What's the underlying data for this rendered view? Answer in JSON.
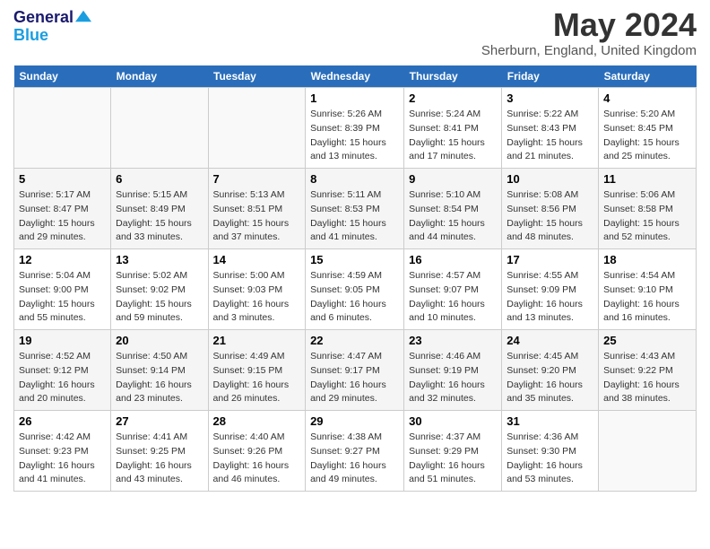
{
  "header": {
    "logo_line1": "General",
    "logo_line2": "Blue",
    "month_year": "May 2024",
    "location": "Sherburn, England, United Kingdom"
  },
  "weekdays": [
    "Sunday",
    "Monday",
    "Tuesday",
    "Wednesday",
    "Thursday",
    "Friday",
    "Saturday"
  ],
  "weeks": [
    [
      {
        "day": "",
        "sunrise": "",
        "sunset": "",
        "daylight": ""
      },
      {
        "day": "",
        "sunrise": "",
        "sunset": "",
        "daylight": ""
      },
      {
        "day": "",
        "sunrise": "",
        "sunset": "",
        "daylight": ""
      },
      {
        "day": "1",
        "sunrise": "Sunrise: 5:26 AM",
        "sunset": "Sunset: 8:39 PM",
        "daylight": "Daylight: 15 hours and 13 minutes."
      },
      {
        "day": "2",
        "sunrise": "Sunrise: 5:24 AM",
        "sunset": "Sunset: 8:41 PM",
        "daylight": "Daylight: 15 hours and 17 minutes."
      },
      {
        "day": "3",
        "sunrise": "Sunrise: 5:22 AM",
        "sunset": "Sunset: 8:43 PM",
        "daylight": "Daylight: 15 hours and 21 minutes."
      },
      {
        "day": "4",
        "sunrise": "Sunrise: 5:20 AM",
        "sunset": "Sunset: 8:45 PM",
        "daylight": "Daylight: 15 hours and 25 minutes."
      }
    ],
    [
      {
        "day": "5",
        "sunrise": "Sunrise: 5:17 AM",
        "sunset": "Sunset: 8:47 PM",
        "daylight": "Daylight: 15 hours and 29 minutes."
      },
      {
        "day": "6",
        "sunrise": "Sunrise: 5:15 AM",
        "sunset": "Sunset: 8:49 PM",
        "daylight": "Daylight: 15 hours and 33 minutes."
      },
      {
        "day": "7",
        "sunrise": "Sunrise: 5:13 AM",
        "sunset": "Sunset: 8:51 PM",
        "daylight": "Daylight: 15 hours and 37 minutes."
      },
      {
        "day": "8",
        "sunrise": "Sunrise: 5:11 AM",
        "sunset": "Sunset: 8:53 PM",
        "daylight": "Daylight: 15 hours and 41 minutes."
      },
      {
        "day": "9",
        "sunrise": "Sunrise: 5:10 AM",
        "sunset": "Sunset: 8:54 PM",
        "daylight": "Daylight: 15 hours and 44 minutes."
      },
      {
        "day": "10",
        "sunrise": "Sunrise: 5:08 AM",
        "sunset": "Sunset: 8:56 PM",
        "daylight": "Daylight: 15 hours and 48 minutes."
      },
      {
        "day": "11",
        "sunrise": "Sunrise: 5:06 AM",
        "sunset": "Sunset: 8:58 PM",
        "daylight": "Daylight: 15 hours and 52 minutes."
      }
    ],
    [
      {
        "day": "12",
        "sunrise": "Sunrise: 5:04 AM",
        "sunset": "Sunset: 9:00 PM",
        "daylight": "Daylight: 15 hours and 55 minutes."
      },
      {
        "day": "13",
        "sunrise": "Sunrise: 5:02 AM",
        "sunset": "Sunset: 9:02 PM",
        "daylight": "Daylight: 15 hours and 59 minutes."
      },
      {
        "day": "14",
        "sunrise": "Sunrise: 5:00 AM",
        "sunset": "Sunset: 9:03 PM",
        "daylight": "Daylight: 16 hours and 3 minutes."
      },
      {
        "day": "15",
        "sunrise": "Sunrise: 4:59 AM",
        "sunset": "Sunset: 9:05 PM",
        "daylight": "Daylight: 16 hours and 6 minutes."
      },
      {
        "day": "16",
        "sunrise": "Sunrise: 4:57 AM",
        "sunset": "Sunset: 9:07 PM",
        "daylight": "Daylight: 16 hours and 10 minutes."
      },
      {
        "day": "17",
        "sunrise": "Sunrise: 4:55 AM",
        "sunset": "Sunset: 9:09 PM",
        "daylight": "Daylight: 16 hours and 13 minutes."
      },
      {
        "day": "18",
        "sunrise": "Sunrise: 4:54 AM",
        "sunset": "Sunset: 9:10 PM",
        "daylight": "Daylight: 16 hours and 16 minutes."
      }
    ],
    [
      {
        "day": "19",
        "sunrise": "Sunrise: 4:52 AM",
        "sunset": "Sunset: 9:12 PM",
        "daylight": "Daylight: 16 hours and 20 minutes."
      },
      {
        "day": "20",
        "sunrise": "Sunrise: 4:50 AM",
        "sunset": "Sunset: 9:14 PM",
        "daylight": "Daylight: 16 hours and 23 minutes."
      },
      {
        "day": "21",
        "sunrise": "Sunrise: 4:49 AM",
        "sunset": "Sunset: 9:15 PM",
        "daylight": "Daylight: 16 hours and 26 minutes."
      },
      {
        "day": "22",
        "sunrise": "Sunrise: 4:47 AM",
        "sunset": "Sunset: 9:17 PM",
        "daylight": "Daylight: 16 hours and 29 minutes."
      },
      {
        "day": "23",
        "sunrise": "Sunrise: 4:46 AM",
        "sunset": "Sunset: 9:19 PM",
        "daylight": "Daylight: 16 hours and 32 minutes."
      },
      {
        "day": "24",
        "sunrise": "Sunrise: 4:45 AM",
        "sunset": "Sunset: 9:20 PM",
        "daylight": "Daylight: 16 hours and 35 minutes."
      },
      {
        "day": "25",
        "sunrise": "Sunrise: 4:43 AM",
        "sunset": "Sunset: 9:22 PM",
        "daylight": "Daylight: 16 hours and 38 minutes."
      }
    ],
    [
      {
        "day": "26",
        "sunrise": "Sunrise: 4:42 AM",
        "sunset": "Sunset: 9:23 PM",
        "daylight": "Daylight: 16 hours and 41 minutes."
      },
      {
        "day": "27",
        "sunrise": "Sunrise: 4:41 AM",
        "sunset": "Sunset: 9:25 PM",
        "daylight": "Daylight: 16 hours and 43 minutes."
      },
      {
        "day": "28",
        "sunrise": "Sunrise: 4:40 AM",
        "sunset": "Sunset: 9:26 PM",
        "daylight": "Daylight: 16 hours and 46 minutes."
      },
      {
        "day": "29",
        "sunrise": "Sunrise: 4:38 AM",
        "sunset": "Sunset: 9:27 PM",
        "daylight": "Daylight: 16 hours and 49 minutes."
      },
      {
        "day": "30",
        "sunrise": "Sunrise: 4:37 AM",
        "sunset": "Sunset: 9:29 PM",
        "daylight": "Daylight: 16 hours and 51 minutes."
      },
      {
        "day": "31",
        "sunrise": "Sunrise: 4:36 AM",
        "sunset": "Sunset: 9:30 PM",
        "daylight": "Daylight: 16 hours and 53 minutes."
      },
      {
        "day": "",
        "sunrise": "",
        "sunset": "",
        "daylight": ""
      }
    ]
  ]
}
